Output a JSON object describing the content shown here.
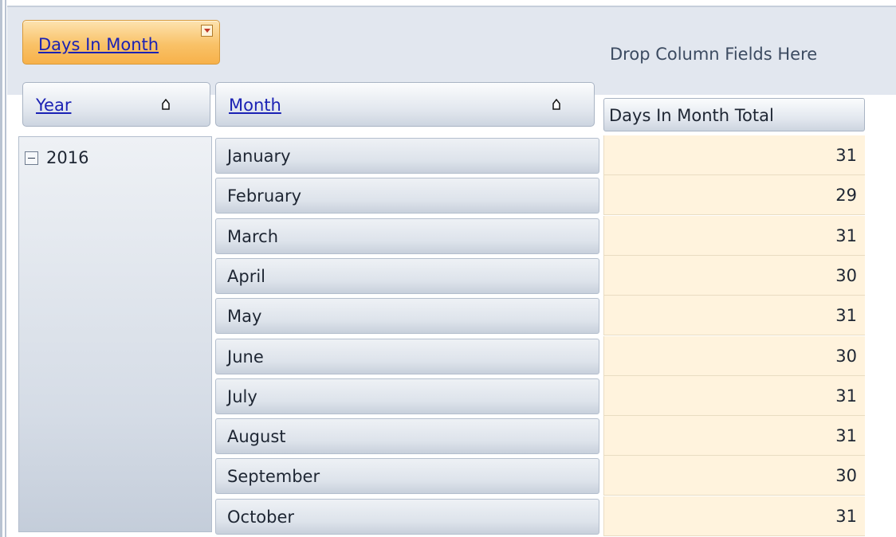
{
  "pivot": {
    "data_field": {
      "label": "Days In Month"
    },
    "column_drop_hint": "Drop Column Fields Here",
    "row_fields": [
      {
        "label": "Year"
      },
      {
        "label": "Month"
      }
    ],
    "data_header": "Days In Month Total",
    "year": "2016",
    "rows": [
      {
        "month": "January",
        "value": "31"
      },
      {
        "month": "February",
        "value": "29"
      },
      {
        "month": "March",
        "value": "31"
      },
      {
        "month": "April",
        "value": "30"
      },
      {
        "month": "May",
        "value": "31"
      },
      {
        "month": "June",
        "value": "30"
      },
      {
        "month": "July",
        "value": "31"
      },
      {
        "month": "August",
        "value": "31"
      },
      {
        "month": "September",
        "value": "30"
      },
      {
        "month": "October",
        "value": "31"
      }
    ]
  }
}
